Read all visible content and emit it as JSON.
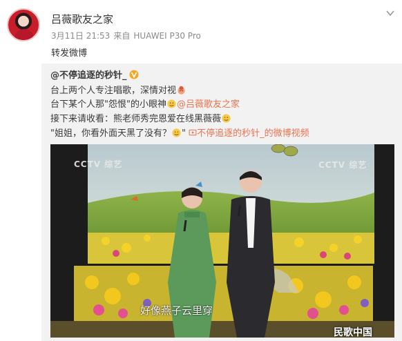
{
  "post": {
    "username": "吕薇歌友之家",
    "date": "3月11日 21:53",
    "source_prefix": "来自",
    "device": "HUAWEI P30 Pro",
    "repost_text": "转发微博"
  },
  "quoted": {
    "author": "@不停追逐的秒针_",
    "line1": "台上两个人专注唱歌，深情对视",
    "line2_text": "台下某个人那\"怨恨\"的小眼神",
    "line2_mention": "@吕薇歌友之家",
    "line3": "接下来请收看：熊老师秀完恩爱在线黑薇薇",
    "line4_text": "\"姐姐，你看外面天黑了没有？",
    "line4_tail": "\"",
    "line4_link": "不停追逐的秒针_的微博视频"
  },
  "video": {
    "channel_logo_left": "CCTV 综艺",
    "channel_logo_right": "CCTV 综艺",
    "subtitle": "好像燕子云里穿",
    "watermark": "民歌中国"
  },
  "colors": {
    "link": "#eb7350",
    "quote_bg": "#f2f2f2",
    "verified": "#f5a623"
  }
}
